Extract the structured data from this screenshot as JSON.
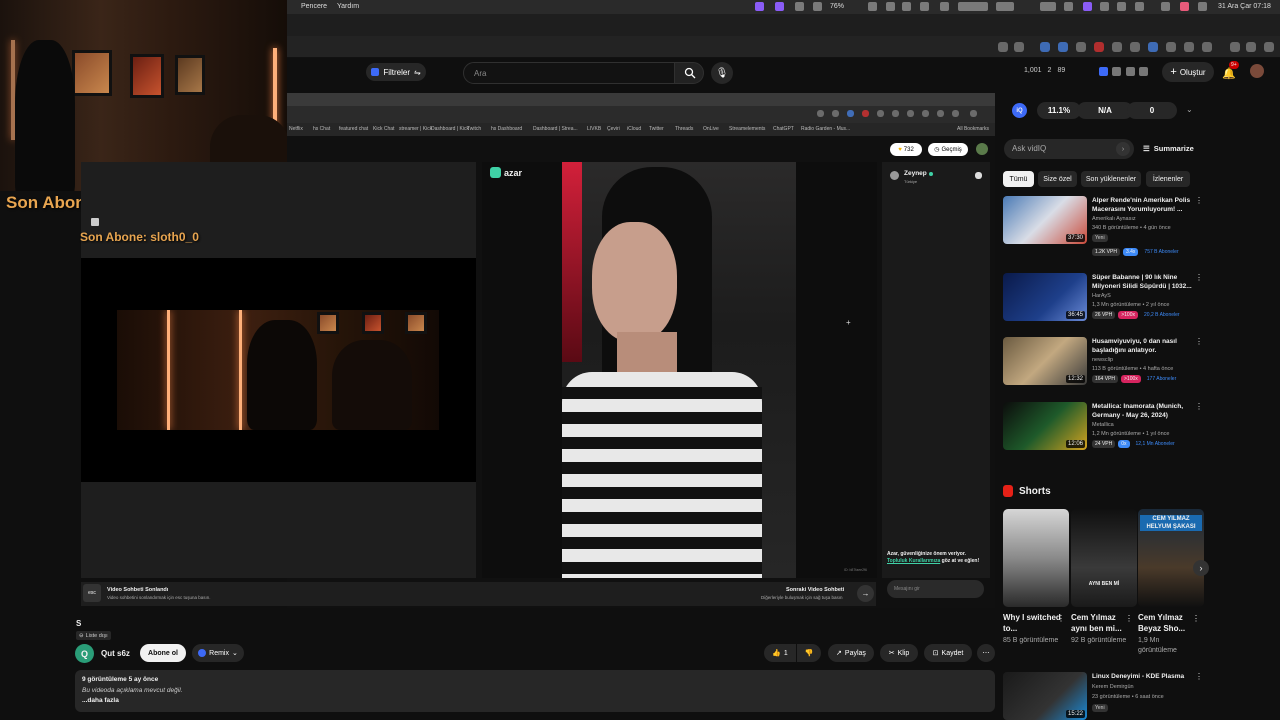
{
  "menubar": {
    "items": [
      "Pencere",
      "Yardım"
    ],
    "battery": "76%",
    "datetime": "31 Ara Çar  07:18"
  },
  "overlay": {
    "son_abone_1": "Son Abone: erksoli",
    "son_abone_2": "Son Abone: sloth0_0"
  },
  "header": {
    "filters_label": "Filtreler",
    "search_placeholder": "Ara",
    "stats": {
      "views": "1,001",
      "watching": "2",
      "subs": "89"
    },
    "create_label": "Oluştur",
    "notif_count": "9+"
  },
  "iq_panel": {
    "pct": "11.1%",
    "na": "N/A",
    "zero": "0",
    "ask_placeholder": "Ask vidIQ",
    "summarize": "Summarize"
  },
  "chips": [
    "Tümü",
    "Size özel",
    "Son yüklenenler",
    "İzlenenler"
  ],
  "embedded": {
    "bookmarks": [
      "Netflix",
      "hs Chat",
      "featured chat",
      "Kick Chat",
      "streamer | Kick",
      "Dashboard | Kick",
      "Twitch",
      "hs Dashboard",
      "Dashboard | Strea...",
      "LIVKB",
      "Çeviri",
      "iCloud",
      "Twitter",
      "Threads",
      "OnLive",
      "Streamelements",
      "ChatGPT",
      "Radio Garden - Mus...",
      "All Bookmarks"
    ],
    "coins": "732",
    "history": "Geçmiş",
    "azar_logo": "azar",
    "user_name": "Zeynep",
    "user_country": "Türkiye",
    "safety_text": "Azar, güvenliğinize önem veriyor.",
    "safety_link": "Topluluk Kurallarımıza",
    "safety_text2": "göz at ve eğlen!",
    "message_placeholder": "Mesajını gir",
    "esc_key": "esc",
    "ended_title": "Video Sohbeti Sonlandı",
    "ended_sub": "Video sohbetini sonlandırmak için esc tuşuna basın.",
    "next_title": "Sonraki Video Sohbeti",
    "next_sub": "Diğerleriyle buluşmak için sağ tuşa basın",
    "watermark": "ID: b87faee2f6"
  },
  "video_info": {
    "title": "S",
    "unlisted": "Liste dışı",
    "avatar_letter": "Q",
    "channel": "Qut s6z",
    "subscribe": "Abone ol",
    "remix": "Remix",
    "likes": "1",
    "share": "Paylaş",
    "clip": "Klip",
    "save": "Kaydet"
  },
  "description": {
    "views_time": "9 görüntüleme  5 ay önce",
    "text": "Bu videoda açıklama mevcut değil.",
    "more": "...daha fazla"
  },
  "recommendations": [
    {
      "title": "Alper Rende'nin Amerikan Polis Macerasını Yorumluyorum! ...",
      "channel": "Amerikalı Aynasız",
      "meta": "340 B görüntüleme • 4 gün önce",
      "tag": "Yeni",
      "vph": "1.2K VPH",
      "mult": "3.4x",
      "subs": "757 B Aboneler",
      "duration": "37:30",
      "multcolor": "#3d8af7"
    },
    {
      "title": "Süper Babanne | 90 lık Nine Milyoneri Silidi Süpürdü | 1032...",
      "channel": "HarAyS",
      "meta": "1,3 Mn görüntüleme • 2 yıl önce",
      "tag": "",
      "vph": "26 VPH",
      "mult": ">100x",
      "subs": "20,2 B Aboneler",
      "duration": "36:45",
      "multcolor": "#d6245f"
    },
    {
      "title": "Husamviyuviyu, 0 dan nasıl başladığını anlatıyor.",
      "channel": "newsclip",
      "meta": "113 B görüntüleme • 4 hafta önce",
      "tag": "",
      "vph": "164 VPH",
      "mult": ">100x",
      "subs": "177 Aboneler",
      "duration": "12:32",
      "multcolor": "#d6245f"
    },
    {
      "title": "Metallica: Inamorata (Munich, Germany - May 26, 2024)",
      "channel": "Metallica",
      "meta": "1,2 Mn görüntüleme • 1 yıl önce",
      "tag": "",
      "vph": "24 VPH",
      "mult": "0x",
      "subs": "12,1 Mn Aboneler",
      "duration": "12:06",
      "multcolor": "#3d8af7"
    }
  ],
  "shorts": {
    "heading": "Shorts",
    "items": [
      {
        "title": "Why I switched to...",
        "views": "85 B görüntüleme"
      },
      {
        "title": "Cem Yılmaz aynı ben mi...",
        "views": "92 B görüntüleme"
      },
      {
        "title": "Cem Yılmaz Beyaz Sho...",
        "views": "1,9 Mn görüntüleme"
      }
    ],
    "overlay_short2": "AYNI BEN Mİ",
    "overlay_short3": "CEM YILMAZ HELYUM ŞAKASI"
  },
  "rec5": {
    "title": "Linux Deneyimi - KDE Plasma",
    "channel": "Kerem Demirgün",
    "meta": "23 görüntüleme • 6 saat önce",
    "tag": "Yeni",
    "duration": "15:22"
  }
}
